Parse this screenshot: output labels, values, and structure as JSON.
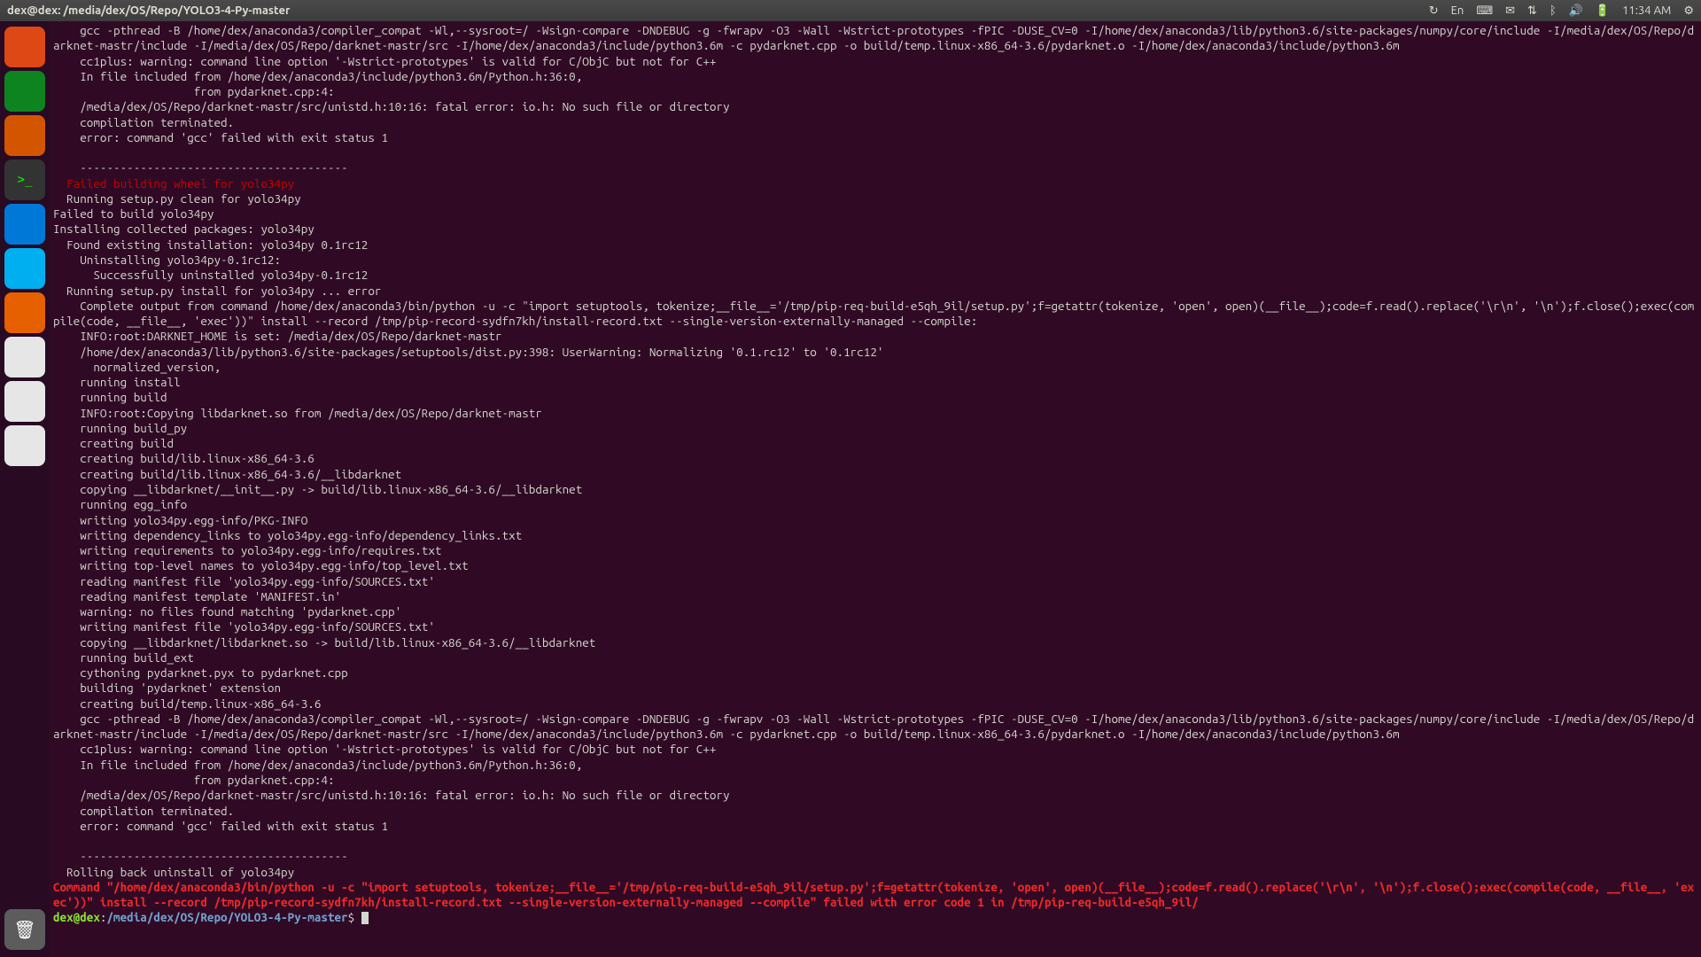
{
  "topbar": {
    "title": "dex@dex: /media/dex/OS/Repo/YOLO3-4-Py-master",
    "lang": "En",
    "time": "11:34 AM"
  },
  "launcher": {
    "items": [
      {
        "name": "ubuntu-dash",
        "cls": "ubuntu"
      },
      {
        "name": "libreoffice-calc",
        "cls": "calc"
      },
      {
        "name": "libreoffice-impress",
        "cls": "impress"
      },
      {
        "name": "terminal",
        "cls": "term"
      },
      {
        "name": "vscode",
        "cls": "vscode"
      },
      {
        "name": "skype",
        "cls": "skype"
      },
      {
        "name": "firefox",
        "cls": "firefox"
      },
      {
        "name": "drive-1",
        "cls": "drive"
      },
      {
        "name": "drive-2",
        "cls": "drive"
      },
      {
        "name": "drive-3",
        "cls": "drive"
      }
    ]
  },
  "terminal": {
    "lines": [
      {
        "t": "    gcc -pthread -B /home/dex/anaconda3/compiler_compat -Wl,--sysroot=/ -Wsign-compare -DNDEBUG -g -fwrapv -O3 -Wall -Wstrict-prototypes -fPIC -DUSE_CV=0 -I/home/dex/anaconda3/lib/python3.6/site-packages/numpy/core/include -I/media/dex/OS/Repo/darknet-mastr/include -I/media/dex/OS/Repo/darknet-mastr/src -I/home/dex/anaconda3/include/python3.6m -c pydarknet.cpp -o build/temp.linux-x86_64-3.6/pydarknet.o -I/home/dex/anaconda3/include/python3.6m"
      },
      {
        "t": "    cc1plus: warning: command line option '-Wstrict-prototypes' is valid for C/ObjC but not for C++"
      },
      {
        "t": "    In file included from /home/dex/anaconda3/include/python3.6m/Python.h:36:0,"
      },
      {
        "t": "                     from pydarknet.cpp:4:"
      },
      {
        "t": "    /media/dex/OS/Repo/darknet-mastr/src/unistd.h:10:16: fatal error: io.h: No such file or directory"
      },
      {
        "t": "    compilation terminated."
      },
      {
        "t": "    error: command 'gcc' failed with exit status 1"
      },
      {
        "t": "    "
      },
      {
        "t": "    ----------------------------------------"
      },
      {
        "t": "  Failed building wheel for yolo34py",
        "c": "red"
      },
      {
        "t": "  Running setup.py clean for yolo34py"
      },
      {
        "t": "Failed to build yolo34py"
      },
      {
        "t": "Installing collected packages: yolo34py"
      },
      {
        "t": "  Found existing installation: yolo34py 0.1rc12"
      },
      {
        "t": "    Uninstalling yolo34py-0.1rc12:"
      },
      {
        "t": "      Successfully uninstalled yolo34py-0.1rc12"
      },
      {
        "t": "  Running setup.py install for yolo34py ... error"
      },
      {
        "t": "    Complete output from command /home/dex/anaconda3/bin/python -u -c \"import setuptools, tokenize;__file__='/tmp/pip-req-build-e5qh_9il/setup.py';f=getattr(tokenize, 'open', open)(__file__);code=f.read().replace('\\r\\n', '\\n');f.close();exec(compile(code, __file__, 'exec'))\" install --record /tmp/pip-record-sydfn7kh/install-record.txt --single-version-externally-managed --compile:"
      },
      {
        "t": "    INFO:root:DARKNET_HOME is set: /media/dex/OS/Repo/darknet-mastr"
      },
      {
        "t": "    /home/dex/anaconda3/lib/python3.6/site-packages/setuptools/dist.py:398: UserWarning: Normalizing '0.1.rc12' to '0.1rc12'"
      },
      {
        "t": "      normalized_version,"
      },
      {
        "t": "    running install"
      },
      {
        "t": "    running build"
      },
      {
        "t": "    INFO:root:Copying libdarknet.so from /media/dex/OS/Repo/darknet-mastr"
      },
      {
        "t": "    running build_py"
      },
      {
        "t": "    creating build"
      },
      {
        "t": "    creating build/lib.linux-x86_64-3.6"
      },
      {
        "t": "    creating build/lib.linux-x86_64-3.6/__libdarknet"
      },
      {
        "t": "    copying __libdarknet/__init__.py -> build/lib.linux-x86_64-3.6/__libdarknet"
      },
      {
        "t": "    running egg_info"
      },
      {
        "t": "    writing yolo34py.egg-info/PKG-INFO"
      },
      {
        "t": "    writing dependency_links to yolo34py.egg-info/dependency_links.txt"
      },
      {
        "t": "    writing requirements to yolo34py.egg-info/requires.txt"
      },
      {
        "t": "    writing top-level names to yolo34py.egg-info/top_level.txt"
      },
      {
        "t": "    reading manifest file 'yolo34py.egg-info/SOURCES.txt'"
      },
      {
        "t": "    reading manifest template 'MANIFEST.in'"
      },
      {
        "t": "    warning: no files found matching 'pydarknet.cpp'"
      },
      {
        "t": "    writing manifest file 'yolo34py.egg-info/SOURCES.txt'"
      },
      {
        "t": "    copying __libdarknet/libdarknet.so -> build/lib.linux-x86_64-3.6/__libdarknet"
      },
      {
        "t": "    running build_ext"
      },
      {
        "t": "    cythoning pydarknet.pyx to pydarknet.cpp"
      },
      {
        "t": "    building 'pydarknet' extension"
      },
      {
        "t": "    creating build/temp.linux-x86_64-3.6"
      },
      {
        "t": "    gcc -pthread -B /home/dex/anaconda3/compiler_compat -Wl,--sysroot=/ -Wsign-compare -DNDEBUG -g -fwrapv -O3 -Wall -Wstrict-prototypes -fPIC -DUSE_CV=0 -I/home/dex/anaconda3/lib/python3.6/site-packages/numpy/core/include -I/media/dex/OS/Repo/darknet-mastr/include -I/media/dex/OS/Repo/darknet-mastr/src -I/home/dex/anaconda3/include/python3.6m -c pydarknet.cpp -o build/temp.linux-x86_64-3.6/pydarknet.o -I/home/dex/anaconda3/include/python3.6m"
      },
      {
        "t": "    cc1plus: warning: command line option '-Wstrict-prototypes' is valid for C/ObjC but not for C++"
      },
      {
        "t": "    In file included from /home/dex/anaconda3/include/python3.6m/Python.h:36:0,"
      },
      {
        "t": "                     from pydarknet.cpp:4:"
      },
      {
        "t": "    /media/dex/OS/Repo/darknet-mastr/src/unistd.h:10:16: fatal error: io.h: No such file or directory"
      },
      {
        "t": "    compilation terminated."
      },
      {
        "t": "    error: command 'gcc' failed with exit status 1"
      },
      {
        "t": "    "
      },
      {
        "t": "    ----------------------------------------"
      },
      {
        "t": "  Rolling back uninstall of yolo34py"
      },
      {
        "t": "Command \"/home/dex/anaconda3/bin/python -u -c \"import setuptools, tokenize;__file__='/tmp/pip-req-build-e5qh_9il/setup.py';f=getattr(tokenize, 'open', open)(__file__);code=f.read().replace('\\r\\n', '\\n');f.close();exec(compile(code, __file__, 'exec'))\" install --record /tmp/pip-record-sydfn7kh/install-record.txt --single-version-externally-managed --compile\" failed with error code 1 in /tmp/pip-req-build-e5qh_9il/",
        "c": "redbold"
      }
    ],
    "prompt": {
      "user": "dex@dex",
      "sep": ":",
      "path": "/media/dex/OS/Repo/YOLO3-4-Py-master",
      "sym": "$"
    }
  }
}
